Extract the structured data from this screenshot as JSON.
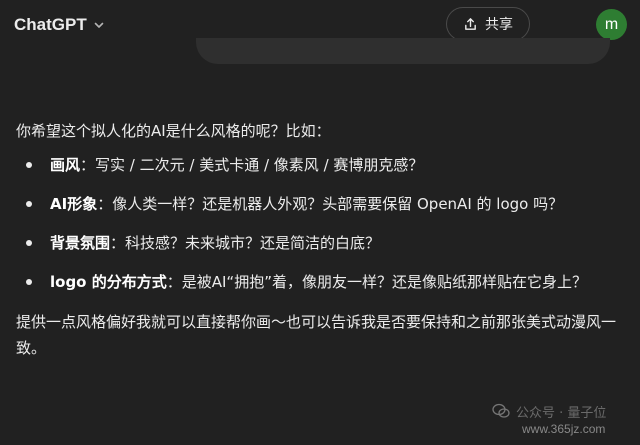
{
  "header": {
    "model_name": "ChatGPT",
    "share_label": "共享",
    "avatar_initial": "m",
    "avatar_color": "#2e7d32"
  },
  "message": {
    "intro": "你希望这个拟人化的AI是什么风格的呢？比如：",
    "items": [
      {
        "title": "画风",
        "sep": "：",
        "text": "写实 / 二次元 / 美式卡通 / 像素风 / 赛博朋克感？"
      },
      {
        "title": "AI形象",
        "sep": "：",
        "text": "像人类一样？还是机器人外观？头部需要保留 OpenAI 的 logo 吗？"
      },
      {
        "title": "背景氛围",
        "sep": "：",
        "text": "科技感？未来城市？还是简洁的白底？"
      },
      {
        "title": "logo 的分布方式",
        "sep": "：",
        "text": "是被AI“拥抱”着，像朋友一样？还是像贴纸那样贴在它身上？"
      }
    ],
    "outro": "提供一点风格偏好我就可以直接帮你画～也可以告诉我是否要保持和之前那张美式动漫风一致。"
  },
  "watermark": {
    "text": "公众号 · 量子位",
    "url": "www.365jz.com"
  }
}
